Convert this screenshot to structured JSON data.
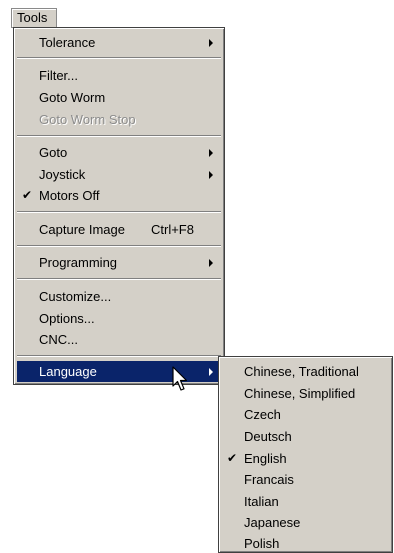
{
  "menubar": {
    "tools_label": "Tools"
  },
  "tools_menu": {
    "tolerance": "Tolerance",
    "filter": "Filter...",
    "goto_worm": "Goto Worm",
    "goto_worm_stop": "Goto Worm Stop",
    "goto": "Goto",
    "joystick": "Joystick",
    "motors_off": "Motors Off",
    "capture_image": "Capture Image",
    "capture_image_shortcut": "Ctrl+F8",
    "programming": "Programming",
    "customize": "Customize...",
    "options": "Options...",
    "cnc": "CNC...",
    "language": "Language"
  },
  "language_menu": {
    "items": [
      "Chinese, Traditional",
      "Chinese, Simplified",
      "Czech",
      "Deutsch",
      "English",
      "Francais",
      "Italian",
      "Japanese",
      "Polish"
    ],
    "checked": "English"
  },
  "icons": {
    "checkmark": "check-icon",
    "submenu_arrow": "submenu-arrow-icon",
    "cursor": "mouse-pointer-icon"
  },
  "colors": {
    "menu_background": "#d4d0c8",
    "highlight": "#0a246a",
    "disabled_text": "#8c8c8c"
  }
}
